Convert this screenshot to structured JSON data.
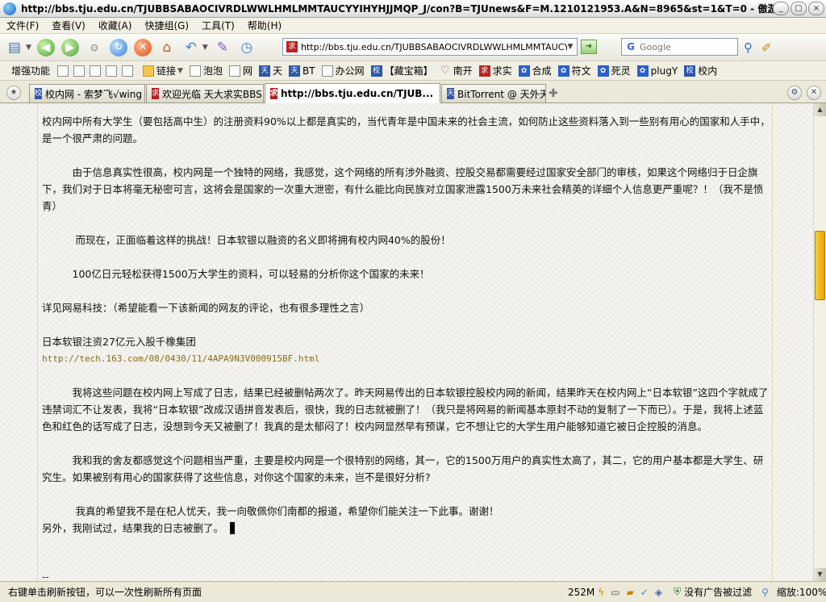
{
  "window": {
    "title": "http://bbs.tju.edu.cn/TJUBBSABAOCIVRDLWWLHMLMMTAUCYYIHYHJJMQP_J/con?B=TJUnews&F=M.1210121953.A&N=8965&st=1&T=0 - 傲游(Maxthon) 2.0.4.5799",
    "minimize": "_",
    "maximize": "□",
    "close": "×"
  },
  "menu": [
    "文件(F)",
    "查看(V)",
    "收藏(A)",
    "快捷组(G)",
    "工具(T)",
    "帮助(H)"
  ],
  "toolbar": {
    "address_url": "http://bbs.tju.edu.cn/TJUBBSABAOCIVRDLWWLHMLMMTAUCYYIHYH",
    "search_placeholder": "Google",
    "search_engine_letter": "G"
  },
  "links_bar": {
    "enhance_label": "增强功能",
    "items": [
      {
        "label": "链接",
        "icon": "folder"
      },
      {
        "label": "泡泡",
        "icon": "page"
      },
      {
        "label": "网",
        "icon": "page"
      },
      {
        "label": "天",
        "icon": "blue",
        "glyph": "天"
      },
      {
        "label": "BT",
        "icon": "blue",
        "glyph": "天"
      },
      {
        "label": "办公网",
        "icon": "page"
      },
      {
        "label": "【藏宝箱】",
        "icon": "blue",
        "glyph": "校"
      },
      {
        "label": "南开",
        "icon": "heart",
        "glyph": "♡"
      },
      {
        "label": "求实",
        "icon": "red",
        "glyph": "求"
      },
      {
        "label": "合成",
        "icon": "paw",
        "glyph": "✿"
      },
      {
        "label": "符文",
        "icon": "paw",
        "glyph": "✿"
      },
      {
        "label": "死灵",
        "icon": "paw",
        "glyph": "✿"
      },
      {
        "label": "plugY",
        "icon": "paw",
        "glyph": "✿"
      },
      {
        "label": "校内",
        "icon": "blue",
        "glyph": "校"
      }
    ]
  },
  "tabs": [
    {
      "label": "校内网 - 索梦飞√wing",
      "glyph": "校",
      "color": "#2b56b0"
    },
    {
      "label": "欢迎光临 天大求实BBS",
      "glyph": "求",
      "color": "#b22222"
    },
    {
      "label": "http://bbs.tju.edu.cn/TJUB...",
      "glyph": "求",
      "color": "#b22222",
      "active": true
    },
    {
      "label": "BitTorrent @ 天外天",
      "glyph": "天",
      "color": "#2b56b0"
    }
  ],
  "post": {
    "p1": "校内网中所有大学生（要包括高中生）的注册资料90%以上都是真实的，当代青年是中国未来的社会主流，如何防止这些资料落入到一些别有用心的国家和人手中，是一个很严肃的问题。",
    "p2": "　　　由于信息真实性很高，校内网是一个独特的网络，我感觉，这个网络的所有涉外融资、控股交易都需要经过国家安全部门的审核，如果这个网络归于日企旗下，我们对于日本将毫无秘密可言，这将会是国家的一次重大泄密，有什么能比向民族对立国家泄露1500万未来社会精英的详细个人信息更严重呢？！（我不是愤青）",
    "p3": "　　　 而现在，正面临着这样的挑战！日本软银以融资的名义即将拥有校内网40%的股份！",
    "p4": "　　　100亿日元轻松获得1500万大学生的资料，可以轻易的分析你这个国家的未来！",
    "p5": "详见网易科技：（希望能看一下该新闻的网友的评论，也有很多理性之言）",
    "p6": "日本软银注资27亿元入股千橡集团",
    "p6_url": "http://tech.163.com/08/0430/11/4APA9N3V000915BF.html",
    "p7": "　　　我将这些问题在校内网上写成了日志，结果已经被删帖两次了。昨天网易传出的日本软银控股校内网的新闻，结果昨天在校内网上“日本软银”这四个字就成了违禁词汇不让发表，我将“日本软银”改成汉语拼音发表后，很快，我的日志就被删了！（我只是将网易的新闻基本原封不动的复制了一下而已）。于是，我将上述蓝色和红色的话写成了日志，没想到今天又被删了！我真的是太郁闷了！校内网显然早有预谋，它不想让它的大学生用户能够知道它被日企控股的消息。",
    "p8": "　　　我和我的舍友都感觉这个问题相当严重，主要是校内网是一个很特别的网络，其一，它的1500万用户的真实性太高了，其二，它的用户基本都是大学生、研究生。如果被别有用心的国家获得了这些信息，对你这个国家的未来，岂不是很好分析?",
    "p9": "　　　 我真的希望我不是在杞人忧天，我一向敬佩你们南都的报道，希望你们能关注一下此事。谢谢！",
    "p10": "另外，我刚试过，结果我的日志被删了。",
    "signature": "--"
  },
  "scrollbar": {
    "up": "▲",
    "down": "▼",
    "position": 0.3,
    "visible_fraction": 0.08
  },
  "status": {
    "message": "右键单击刷新按钮，可以一次性刷新所有页面",
    "memory": "252M",
    "adblock": "没有广告被过滤",
    "zoom": "缩放:100%"
  },
  "colors": {
    "scroll_thumb": "#f0b800",
    "link_url": "#8a6d12"
  }
}
